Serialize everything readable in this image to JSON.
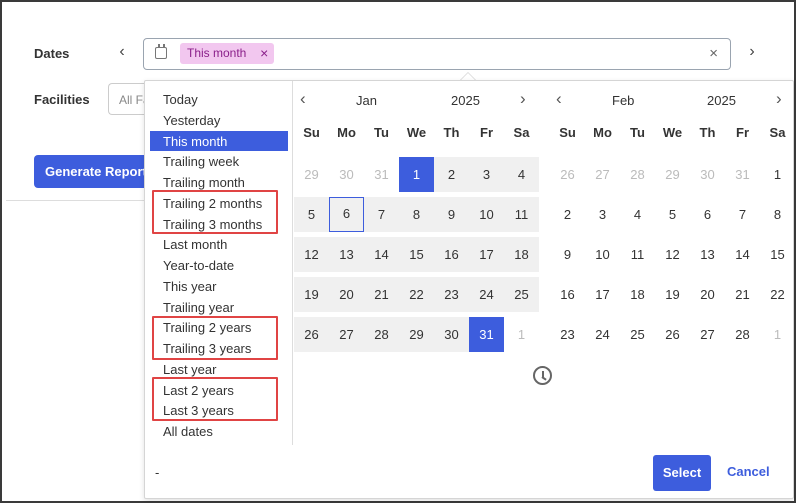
{
  "form": {
    "dates_label": "Dates",
    "facilities_label": "Facilities",
    "facilities_placeholder": "All Fa",
    "chip_label": "This month",
    "chip_remove": "×",
    "clear": "×",
    "prev": "‹",
    "next": "›",
    "generate_label": "Generate Report"
  },
  "presets": [
    {
      "label": "Today"
    },
    {
      "label": "Yesterday"
    },
    {
      "label": "This month",
      "selected": true
    },
    {
      "label": "Trailing week"
    },
    {
      "label": "Trailing month"
    },
    {
      "label": "Trailing 2 months"
    },
    {
      "label": "Trailing 3 months"
    },
    {
      "label": "Last month"
    },
    {
      "label": "Year-to-date"
    },
    {
      "label": "This year"
    },
    {
      "label": "Trailing year"
    },
    {
      "label": "Trailing 2 years"
    },
    {
      "label": "Trailing 3 years"
    },
    {
      "label": "Last year"
    },
    {
      "label": "Last 2 years"
    },
    {
      "label": "Last 3 years"
    },
    {
      "label": "All dates"
    }
  ],
  "calendars": [
    {
      "month": "Jan",
      "year": "2025",
      "weekdays": [
        "Su",
        "Mo",
        "Tu",
        "We",
        "Th",
        "Fr",
        "Sa"
      ],
      "weeks": [
        [
          {
            "d": "29",
            "m": 1
          },
          {
            "d": "30",
            "m": 1
          },
          {
            "d": "31",
            "m": 1
          },
          {
            "d": "1",
            "s": 1
          },
          {
            "d": "2"
          },
          {
            "d": "3"
          },
          {
            "d": "4"
          }
        ],
        [
          {
            "d": "5"
          },
          {
            "d": "6",
            "t": 1
          },
          {
            "d": "7"
          },
          {
            "d": "8"
          },
          {
            "d": "9"
          },
          {
            "d": "10"
          },
          {
            "d": "11"
          }
        ],
        [
          {
            "d": "12"
          },
          {
            "d": "13"
          },
          {
            "d": "14"
          },
          {
            "d": "15"
          },
          {
            "d": "16"
          },
          {
            "d": "17"
          },
          {
            "d": "18"
          }
        ],
        [
          {
            "d": "19"
          },
          {
            "d": "20"
          },
          {
            "d": "21"
          },
          {
            "d": "22"
          },
          {
            "d": "23"
          },
          {
            "d": "24"
          },
          {
            "d": "25"
          }
        ],
        [
          {
            "d": "26"
          },
          {
            "d": "27"
          },
          {
            "d": "28"
          },
          {
            "d": "29"
          },
          {
            "d": "30"
          },
          {
            "d": "31",
            "s": 1
          },
          {
            "d": "1",
            "m": 1
          }
        ]
      ]
    },
    {
      "month": "Feb",
      "year": "2025",
      "weekdays": [
        "Su",
        "Mo",
        "Tu",
        "We",
        "Th",
        "Fr",
        "Sa"
      ],
      "weeks": [
        [
          {
            "d": "26",
            "m": 1
          },
          {
            "d": "27",
            "m": 1
          },
          {
            "d": "28",
            "m": 1
          },
          {
            "d": "29",
            "m": 1
          },
          {
            "d": "30",
            "m": 1
          },
          {
            "d": "31",
            "m": 1
          },
          {
            "d": "1"
          }
        ],
        [
          {
            "d": "2"
          },
          {
            "d": "3"
          },
          {
            "d": "4"
          },
          {
            "d": "5"
          },
          {
            "d": "6"
          },
          {
            "d": "7"
          },
          {
            "d": "8"
          }
        ],
        [
          {
            "d": "9"
          },
          {
            "d": "10"
          },
          {
            "d": "11"
          },
          {
            "d": "12"
          },
          {
            "d": "13"
          },
          {
            "d": "14"
          },
          {
            "d": "15"
          }
        ],
        [
          {
            "d": "16"
          },
          {
            "d": "17"
          },
          {
            "d": "18"
          },
          {
            "d": "19"
          },
          {
            "d": "20"
          },
          {
            "d": "21"
          },
          {
            "d": "22"
          }
        ],
        [
          {
            "d": "23"
          },
          {
            "d": "24"
          },
          {
            "d": "25"
          },
          {
            "d": "26"
          },
          {
            "d": "27"
          },
          {
            "d": "28"
          },
          {
            "d": "1",
            "m": 1
          }
        ]
      ]
    }
  ],
  "footer": {
    "dash": "-",
    "select_label": "Select",
    "cancel_label": "Cancel"
  },
  "icons": [
    "calendar-icon",
    "clock-icon",
    "chevron-left-icon",
    "chevron-right-icon"
  ],
  "colors": {
    "accent": "#3d5ddd",
    "chip_bg": "#f2c7ef",
    "highlight_box": "#e04444"
  }
}
